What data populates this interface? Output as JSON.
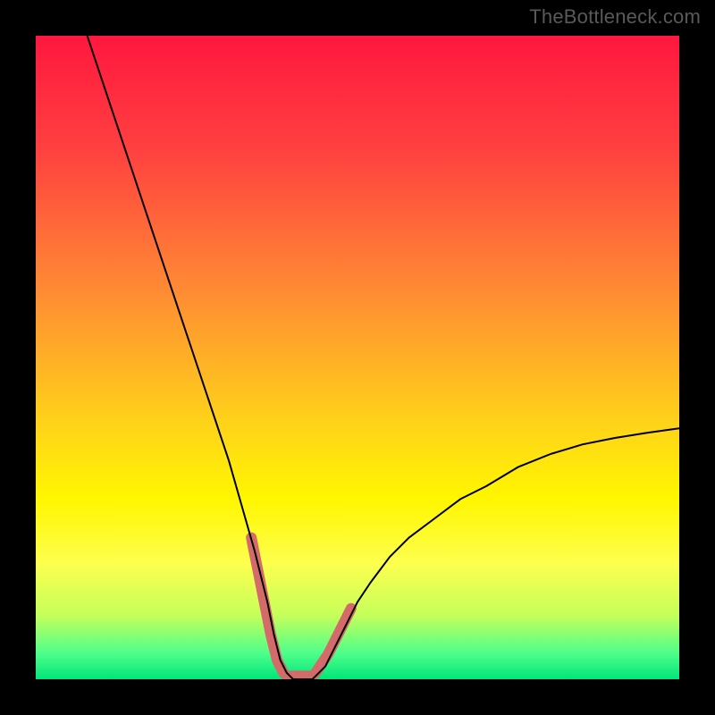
{
  "watermark": "TheBottleneck.com",
  "chart_data": {
    "type": "line",
    "title": "",
    "xlabel": "",
    "ylabel": "",
    "xlim": [
      0,
      100
    ],
    "ylim": [
      0,
      100
    ],
    "background_gradient_stops": [
      {
        "offset": 0.0,
        "color": "#ff173f"
      },
      {
        "offset": 0.18,
        "color": "#ff4140"
      },
      {
        "offset": 0.4,
        "color": "#ff8c33"
      },
      {
        "offset": 0.6,
        "color": "#ffd21a"
      },
      {
        "offset": 0.72,
        "color": "#fff600"
      },
      {
        "offset": 0.82,
        "color": "#fdff4e"
      },
      {
        "offset": 0.9,
        "color": "#c6ff5a"
      },
      {
        "offset": 0.96,
        "color": "#4dff8a"
      },
      {
        "offset": 1.0,
        "color": "#00e57a"
      }
    ],
    "series": [
      {
        "name": "curve",
        "stroke": "#000000",
        "stroke_width": 2,
        "x": [
          8,
          10,
          12,
          14,
          16,
          18,
          20,
          22,
          24,
          26,
          28,
          30,
          32,
          34,
          35,
          36,
          37,
          38,
          39,
          40,
          41,
          42,
          43,
          44,
          45,
          46,
          48,
          50,
          52,
          55,
          58,
          62,
          66,
          70,
          75,
          80,
          85,
          90,
          95,
          100
        ],
        "y": [
          100,
          94,
          88,
          82,
          76,
          70,
          64,
          58,
          52,
          46,
          40,
          34,
          27,
          20,
          16,
          12,
          7,
          3,
          1,
          0,
          0,
          0,
          0,
          1,
          2,
          4,
          8,
          12,
          15,
          19,
          22,
          25,
          28,
          30,
          33,
          35,
          36.5,
          37.5,
          38.3,
          39
        ]
      },
      {
        "name": "floor-highlight",
        "stroke": "#d46a6a",
        "stroke_width": 12,
        "segments": [
          {
            "x": [
              33.5,
              34.5,
              35.5,
              36.5,
              37.5,
              38.5
            ],
            "y": [
              22,
              17,
              12,
              7,
              3,
              1
            ]
          },
          {
            "x": [
              39,
              40,
              41,
              42,
              43
            ],
            "y": [
              0.5,
              0.5,
              0.5,
              0.5,
              0.5
            ]
          },
          {
            "x": [
              43.5,
              44.5,
              45.5,
              46.5,
              48,
              49
            ],
            "y": [
              1,
              2.5,
              4,
              6,
              9,
              11
            ]
          }
        ]
      }
    ]
  }
}
